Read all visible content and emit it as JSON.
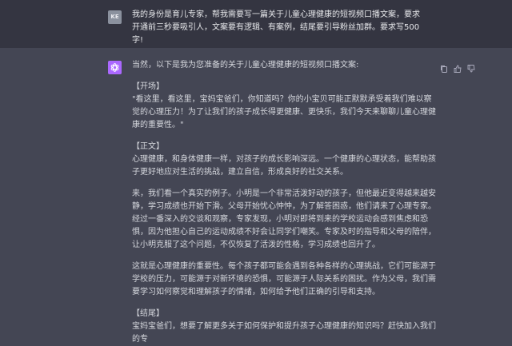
{
  "user": {
    "avatar_initials": "KE",
    "message": "我的身份是育儿专家，帮我需要写一篇关于儿童心理健康的短视频口播文案，要求开通前三秒要吸引人，文案要有逻辑、有案例，结尾要引导粉丝加群。要求写500字!"
  },
  "assistant": {
    "intro": "当然，以下是我为您准备的关于儿童心理健康的短视频口播文案:",
    "sections": {
      "opening_heading": "【开场】",
      "opening_text": "\"看这里，看这里，宝妈宝爸们，你知道吗？你的小宝贝可能正默默承受着我们难以察觉的心理压力！为了让我们的孩子成长得更健康、更快乐，我们今天来聊聊儿童心理健康的重要性。\"",
      "body_heading": "【正文】",
      "body_p1": "心理健康，和身体健康一样，对孩子的成长影响深远。一个健康的心理状态，能帮助孩子更好地应对生活的挑战，建立自信，形成良好的社交关系。",
      "body_p2": "来，我们看一个真实的例子。小明是一个非常活泼好动的孩子，但他最近变得越来越安静，学习成绩也开始下滑。父母开始忧心忡忡，为了解答困惑，他们请来了心理专家。经过一番深入的交谈和观察，专家发现，小明对即将到来的学校运动会感到焦虑和恐惧，因为他担心自己的运动成绩不好会让同学们嘲笑。专家及时的指导和父母的陪伴，让小明克服了这个问题，不仅恢复了活泼的性格，学习成绩也回升了。",
      "body_p3": "这就是心理健康的重要性。每个孩子都可能会遇到各种各样的心理挑战，它们可能源于学校的压力，可能源于对新环境的恐惧，可能源于人际关系的困扰。作为父母，我们需要学习如何察觉和理解孩子的情绪，如何给予他们正确的引导和支持。",
      "ending_heading": "【结尾】",
      "ending_text": "宝妈宝爸们，想要了解更多关于如何保护和提升孩子心理健康的知识吗？赶快加入我们的专"
    }
  },
  "icons": [
    "copy-icon",
    "thumbs-up-icon",
    "thumbs-down-icon"
  ]
}
